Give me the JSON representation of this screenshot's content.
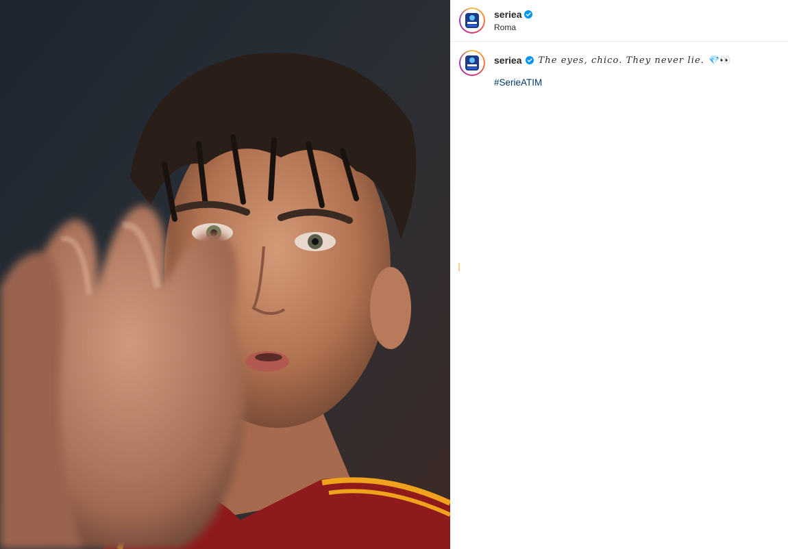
{
  "post": {
    "account": {
      "username": "seriea",
      "verified": true,
      "location": "Roma",
      "avatar_icon": "serie-a-logo"
    },
    "caption": {
      "username": "seriea",
      "text": "The eyes, chico. They never lie.",
      "emojis": "💎👀",
      "hashtag": "#SerieATIM"
    },
    "colors": {
      "verified_blue": "#0095f6",
      "hashtag_blue": "#00376b",
      "text": "#262626",
      "divider": "#efefef",
      "jersey_red": "#8e1a1c",
      "jersey_stripe": "#f0a21c"
    }
  }
}
